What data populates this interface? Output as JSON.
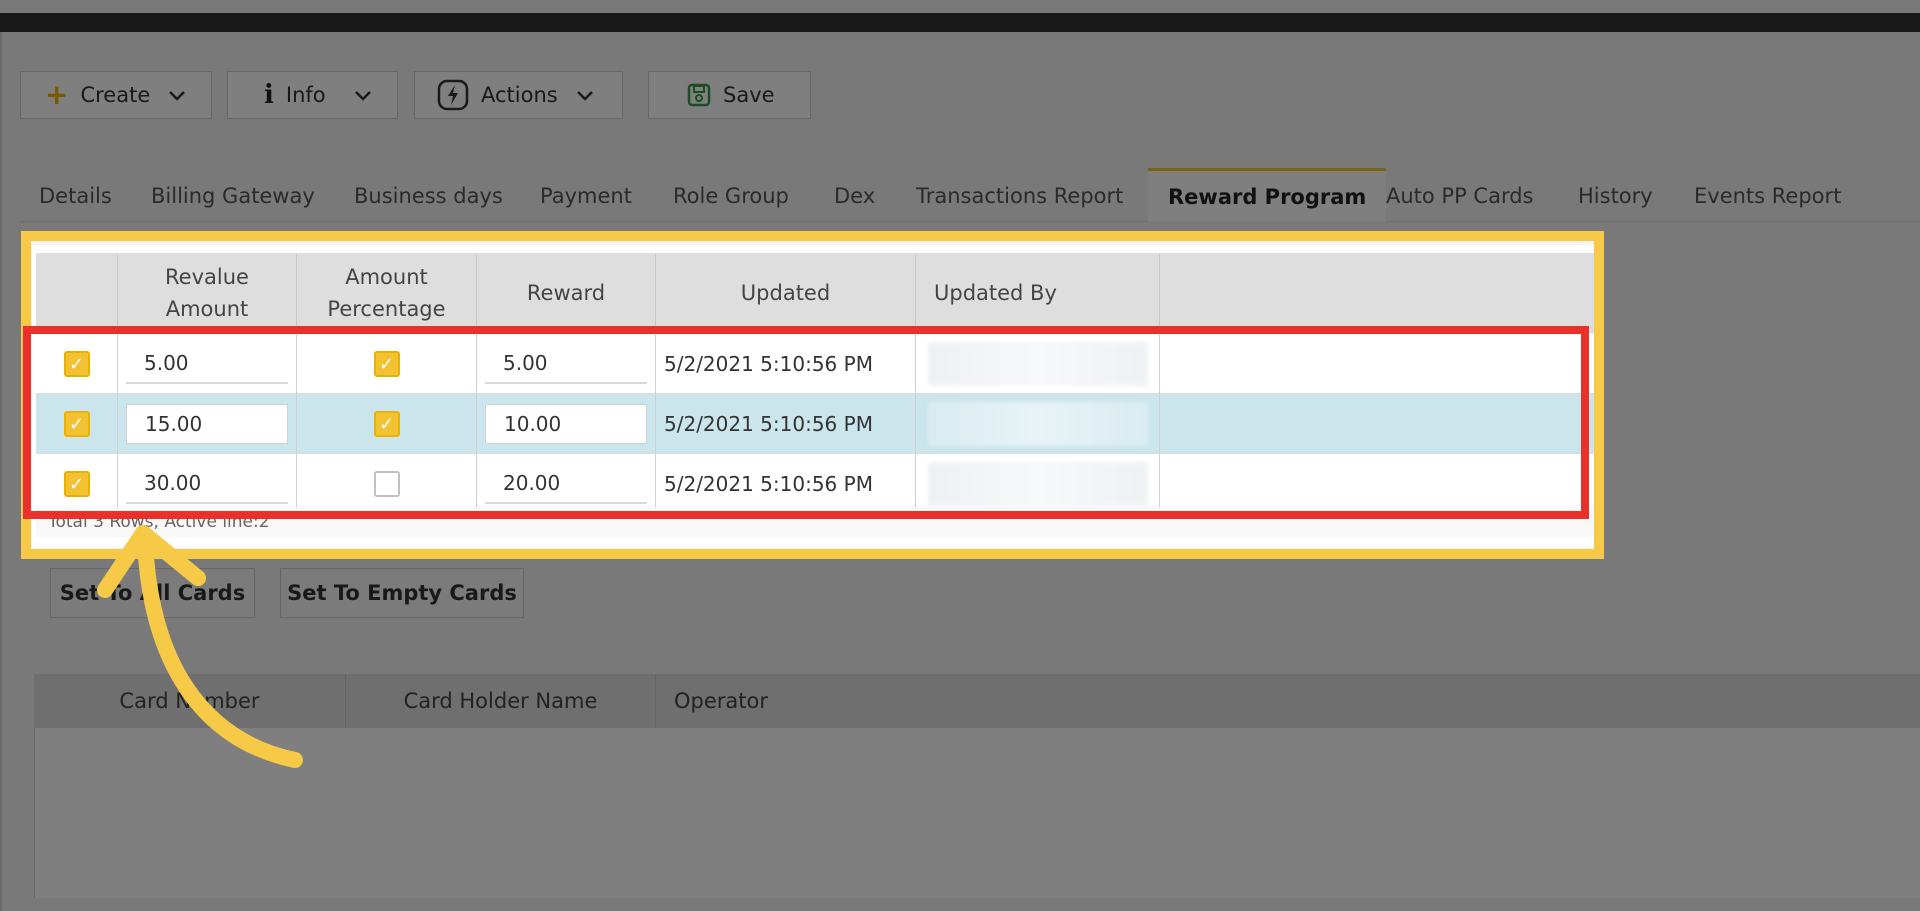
{
  "toolbar": {
    "create_label": "Create",
    "info_label": "Info",
    "actions_label": "Actions",
    "save_label": "Save"
  },
  "tabs": [
    {
      "label": "Details"
    },
    {
      "label": "Billing Gateway"
    },
    {
      "label": "Business days"
    },
    {
      "label": "Payment"
    },
    {
      "label": "Role Group"
    },
    {
      "label": "Dex"
    },
    {
      "label": "Transactions Report"
    },
    {
      "label": "Reward Program",
      "active": true
    },
    {
      "label": "Auto PP Cards"
    },
    {
      "label": "History"
    },
    {
      "label": "Events Report"
    }
  ],
  "reward_grid": {
    "headers": {
      "revalue_line1": "Revalue",
      "revalue_line2": "Amount",
      "amount_pct_line1": "Amount",
      "amount_pct_line2": "Percentage",
      "reward": "Reward",
      "updated": "Updated",
      "updated_by": "Updated By"
    },
    "rows": [
      {
        "selected": true,
        "revalue_amount": "5.00",
        "amount_percentage": true,
        "reward": "5.00",
        "updated": "5/2/2021 5:10:56 PM"
      },
      {
        "selected": true,
        "revalue_amount": "15.00",
        "amount_percentage": true,
        "reward": "10.00",
        "updated": "5/2/2021 5:10:56 PM"
      },
      {
        "selected": true,
        "revalue_amount": "30.00",
        "amount_percentage": false,
        "reward": "20.00",
        "updated": "5/2/2021 5:10:56 PM"
      }
    ],
    "footer": "Total 3 Rows, Active line:2"
  },
  "card_buttons": {
    "set_all": "Set To All Cards",
    "set_empty": "Set To Empty Cards"
  },
  "cards_grid": {
    "headers": {
      "card_number": "Card Number",
      "card_holder": "Card Holder Name",
      "operator": "Operator"
    }
  },
  "colors": {
    "accent": "#f2c233",
    "highlight_outer": "#f6c946",
    "highlight_inner": "#e9302a",
    "active_row": "#cbe5ec"
  }
}
